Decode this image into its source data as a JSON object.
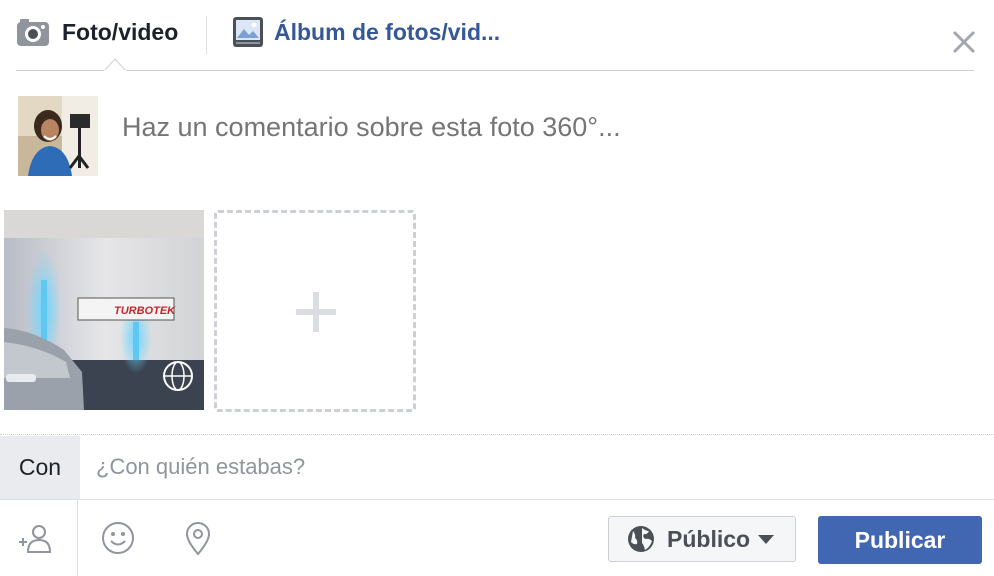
{
  "tabs": {
    "photo_video": "Foto/video",
    "album": "Álbum de fotos/vid..."
  },
  "composer": {
    "comment_placeholder": "Haz un comentario sobre esta foto 360°..."
  },
  "with": {
    "label": "Con",
    "placeholder": "¿Con quién estabas?"
  },
  "footer": {
    "privacy_label": "Público",
    "publish_label": "Publicar"
  },
  "icons": {
    "camera": "camera-icon",
    "album": "album-icon",
    "close": "close-icon",
    "degree_360": "globe-360-icon",
    "plus": "plus-icon",
    "tag": "tag-friends-icon",
    "feeling": "smiley-icon",
    "location": "location-pin-icon",
    "privacy": "globe-icon",
    "dropdown": "caret-down-icon"
  },
  "colors": {
    "accent": "#4267b2",
    "link": "#365899",
    "placeholder": "#90949c"
  }
}
